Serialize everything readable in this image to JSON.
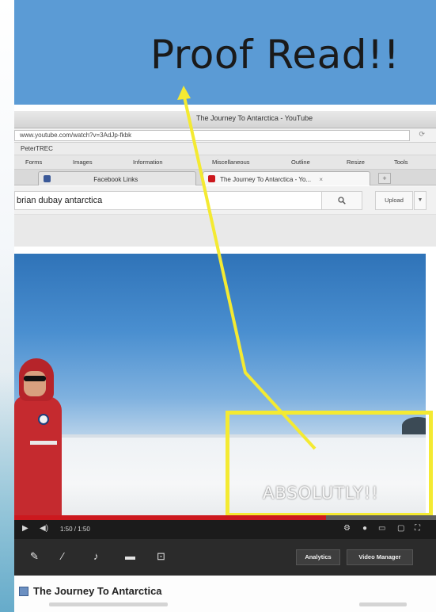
{
  "slide": {
    "title": "Proof Read!!"
  },
  "browser": {
    "window_title": "The Journey To Antarctica - YouTube",
    "url": "www.youtube.com/watch?v=3AdJp-fkbk",
    "bookmark_bar_item": "PeterTREC",
    "bookmarks": [
      "Forms",
      "Images",
      "Information",
      "Miscellaneous",
      "Outline",
      "Resize",
      "Tools"
    ],
    "tabs": [
      {
        "label": "Facebook Links"
      },
      {
        "label": "The Journey To Antarctica - Yo..."
      }
    ],
    "new_tab_label": "+"
  },
  "youtube": {
    "search_value": "brian dubay antarctica",
    "search_icon": "search-icon",
    "upload_label": "Upload",
    "video_overlay_text": "ABSOLUTLY!!",
    "time_display": "1:50 / 1:50",
    "progress": 0.74,
    "analytics_label": "Analytics",
    "video_manager_label": "Video Manager",
    "video_title": "The Journey To Antarctica"
  },
  "colors": {
    "slide_band": "#5b9bd5",
    "annotation": "#f4ea32",
    "youtube_red": "#cc181e"
  }
}
